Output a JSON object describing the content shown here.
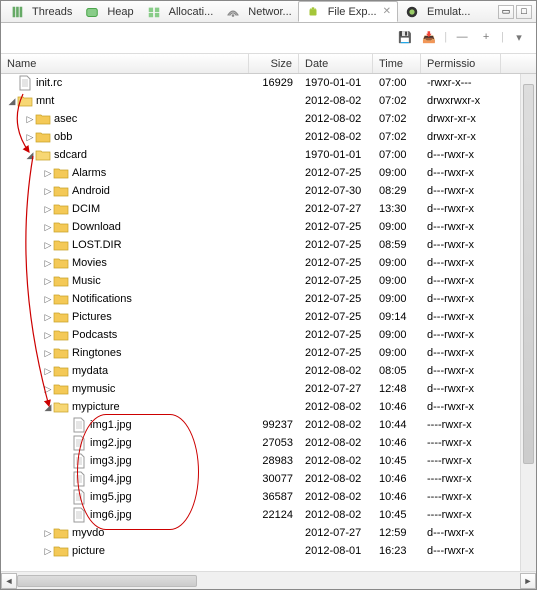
{
  "tabs": [
    {
      "icon": "threads",
      "label": "Threads"
    },
    {
      "icon": "heap",
      "label": "Heap"
    },
    {
      "icon": "alloc",
      "label": "Allocati..."
    },
    {
      "icon": "net",
      "label": "Networ..."
    },
    {
      "icon": "android",
      "label": "File Exp...",
      "active": true,
      "close": true
    },
    {
      "icon": "emu",
      "label": "Emulat..."
    }
  ],
  "tab_ctrl": {
    "min": "▭",
    "max": "□"
  },
  "toolbar": {
    "save": "💾",
    "push": "📥",
    "minus": "—",
    "plus": "+",
    "menu": "▾"
  },
  "headers": {
    "name": "Name",
    "size": "Size",
    "date": "Date",
    "time": "Time",
    "perm": "Permissio"
  },
  "rows": [
    {
      "depth": 0,
      "exp": null,
      "type": "file",
      "name": "init.rc",
      "size": "16929",
      "date": "1970-01-01",
      "time": "07:00",
      "perm": "-rwxr-x---"
    },
    {
      "depth": 0,
      "exp": "open",
      "type": "folder",
      "name": "mnt",
      "size": "",
      "date": "2012-08-02",
      "time": "07:02",
      "perm": "drwxrwxr-x"
    },
    {
      "depth": 1,
      "exp": "closed",
      "type": "folder",
      "name": "asec",
      "size": "",
      "date": "2012-08-02",
      "time": "07:02",
      "perm": "drwxr-xr-x"
    },
    {
      "depth": 1,
      "exp": "closed",
      "type": "folder",
      "name": "obb",
      "size": "",
      "date": "2012-08-02",
      "time": "07:02",
      "perm": "drwxr-xr-x"
    },
    {
      "depth": 1,
      "exp": "open",
      "type": "folder",
      "name": "sdcard",
      "size": "",
      "date": "1970-01-01",
      "time": "07:00",
      "perm": "d---rwxr-x"
    },
    {
      "depth": 2,
      "exp": "closed",
      "type": "folder",
      "name": "Alarms",
      "size": "",
      "date": "2012-07-25",
      "time": "09:00",
      "perm": "d---rwxr-x"
    },
    {
      "depth": 2,
      "exp": "closed",
      "type": "folder",
      "name": "Android",
      "size": "",
      "date": "2012-07-30",
      "time": "08:29",
      "perm": "d---rwxr-x"
    },
    {
      "depth": 2,
      "exp": "closed",
      "type": "folder",
      "name": "DCIM",
      "size": "",
      "date": "2012-07-27",
      "time": "13:30",
      "perm": "d---rwxr-x"
    },
    {
      "depth": 2,
      "exp": "closed",
      "type": "folder",
      "name": "Download",
      "size": "",
      "date": "2012-07-25",
      "time": "09:00",
      "perm": "d---rwxr-x"
    },
    {
      "depth": 2,
      "exp": "closed",
      "type": "folder",
      "name": "LOST.DIR",
      "size": "",
      "date": "2012-07-25",
      "time": "08:59",
      "perm": "d---rwxr-x"
    },
    {
      "depth": 2,
      "exp": "closed",
      "type": "folder",
      "name": "Movies",
      "size": "",
      "date": "2012-07-25",
      "time": "09:00",
      "perm": "d---rwxr-x"
    },
    {
      "depth": 2,
      "exp": "closed",
      "type": "folder",
      "name": "Music",
      "size": "",
      "date": "2012-07-25",
      "time": "09:00",
      "perm": "d---rwxr-x"
    },
    {
      "depth": 2,
      "exp": "closed",
      "type": "folder",
      "name": "Notifications",
      "size": "",
      "date": "2012-07-25",
      "time": "09:00",
      "perm": "d---rwxr-x"
    },
    {
      "depth": 2,
      "exp": "closed",
      "type": "folder",
      "name": "Pictures",
      "size": "",
      "date": "2012-07-25",
      "time": "09:14",
      "perm": "d---rwxr-x"
    },
    {
      "depth": 2,
      "exp": "closed",
      "type": "folder",
      "name": "Podcasts",
      "size": "",
      "date": "2012-07-25",
      "time": "09:00",
      "perm": "d---rwxr-x"
    },
    {
      "depth": 2,
      "exp": "closed",
      "type": "folder",
      "name": "Ringtones",
      "size": "",
      "date": "2012-07-25",
      "time": "09:00",
      "perm": "d---rwxr-x"
    },
    {
      "depth": 2,
      "exp": "closed",
      "type": "folder",
      "name": "mydata",
      "size": "",
      "date": "2012-08-02",
      "time": "08:05",
      "perm": "d---rwxr-x"
    },
    {
      "depth": 2,
      "exp": "closed",
      "type": "folder",
      "name": "mymusic",
      "size": "",
      "date": "2012-07-27",
      "time": "12:48",
      "perm": "d---rwxr-x"
    },
    {
      "depth": 2,
      "exp": "open",
      "type": "folder",
      "name": "mypicture",
      "size": "",
      "date": "2012-08-02",
      "time": "10:46",
      "perm": "d---rwxr-x"
    },
    {
      "depth": 3,
      "exp": null,
      "type": "file",
      "name": "img1.jpg",
      "size": "99237",
      "date": "2012-08-02",
      "time": "10:44",
      "perm": "----rwxr-x"
    },
    {
      "depth": 3,
      "exp": null,
      "type": "file",
      "name": "img2.jpg",
      "size": "27053",
      "date": "2012-08-02",
      "time": "10:46",
      "perm": "----rwxr-x"
    },
    {
      "depth": 3,
      "exp": null,
      "type": "file",
      "name": "img3.jpg",
      "size": "28983",
      "date": "2012-08-02",
      "time": "10:45",
      "perm": "----rwxr-x"
    },
    {
      "depth": 3,
      "exp": null,
      "type": "file",
      "name": "img4.jpg",
      "size": "30077",
      "date": "2012-08-02",
      "time": "10:46",
      "perm": "----rwxr-x"
    },
    {
      "depth": 3,
      "exp": null,
      "type": "file",
      "name": "img5.jpg",
      "size": "36587",
      "date": "2012-08-02",
      "time": "10:46",
      "perm": "----rwxr-x"
    },
    {
      "depth": 3,
      "exp": null,
      "type": "file",
      "name": "img6.jpg",
      "size": "22124",
      "date": "2012-08-02",
      "time": "10:45",
      "perm": "----rwxr-x"
    },
    {
      "depth": 2,
      "exp": "closed",
      "type": "folder",
      "name": "myvdo",
      "size": "",
      "date": "2012-07-27",
      "time": "12:59",
      "perm": "d---rwxr-x"
    },
    {
      "depth": 2,
      "exp": "closed",
      "type": "folder",
      "name": "picture",
      "size": "",
      "date": "2012-08-01",
      "time": "16:23",
      "perm": "d---rwxr-x"
    }
  ]
}
